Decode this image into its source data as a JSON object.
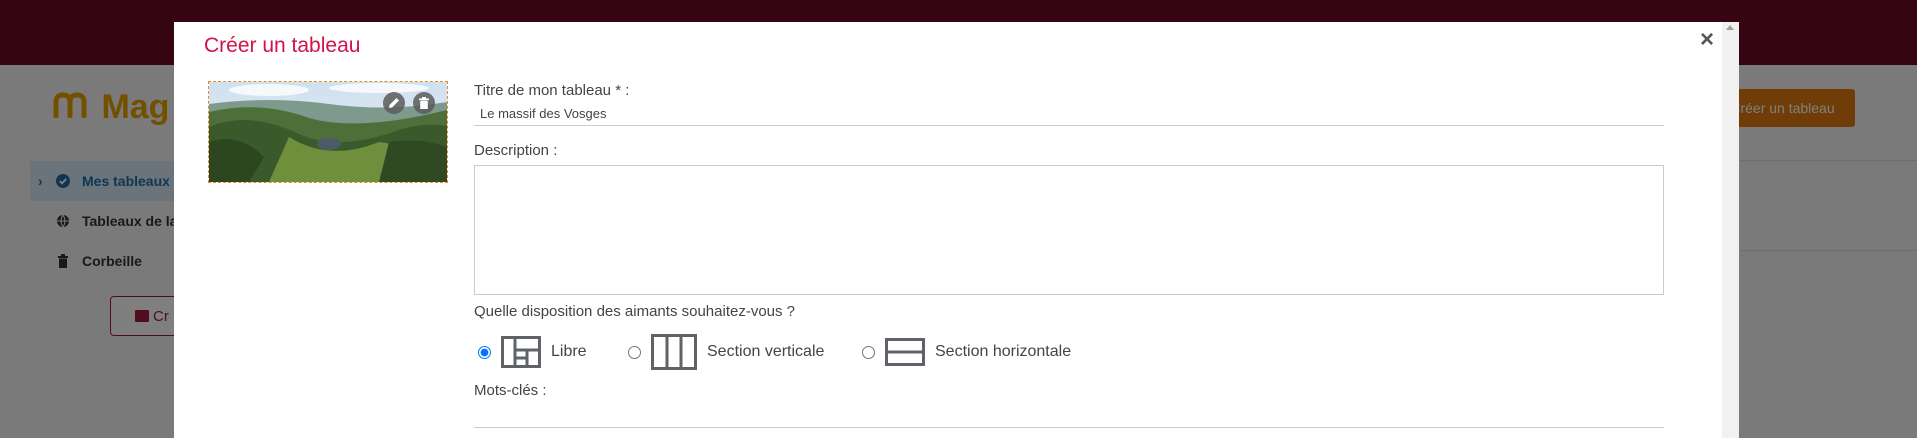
{
  "background": {
    "logo_text": "Mag",
    "sidebar": {
      "items": [
        {
          "label": "Mes tableaux",
          "icon": "check-circle-icon",
          "active": true
        },
        {
          "label": "Tableaux de la",
          "icon": "globe-icon",
          "active": false
        },
        {
          "label": "Corbeille",
          "icon": "trash-icon",
          "active": false
        }
      ],
      "create_label": "Cr"
    },
    "header_button": "Créer un tableau"
  },
  "modal": {
    "title": "Créer un tableau",
    "close_icon": "×",
    "thumbnail": {
      "edit_icon": "pencil-icon",
      "delete_icon": "trash-icon"
    },
    "title_field": {
      "label": "Titre de mon tableau * :",
      "value": "Le massif des Vosges"
    },
    "description": {
      "label": "Description :",
      "value": ""
    },
    "layout": {
      "question": "Quelle disposition des aimants souhaitez-vous ?",
      "options": [
        {
          "label": "Libre",
          "icon": "free-layout-icon",
          "selected": true
        },
        {
          "label": "Section verticale",
          "icon": "vertical-sections-icon",
          "selected": false
        },
        {
          "label": "Section horizontale",
          "icon": "horizontal-sections-icon",
          "selected": false
        }
      ]
    },
    "keywords": {
      "label": "Mots-clés :"
    }
  },
  "colors": {
    "accent": "#d3124a",
    "header": "#6a0a25",
    "orange": "#e07a10",
    "icon_gray": "#5f6368"
  }
}
